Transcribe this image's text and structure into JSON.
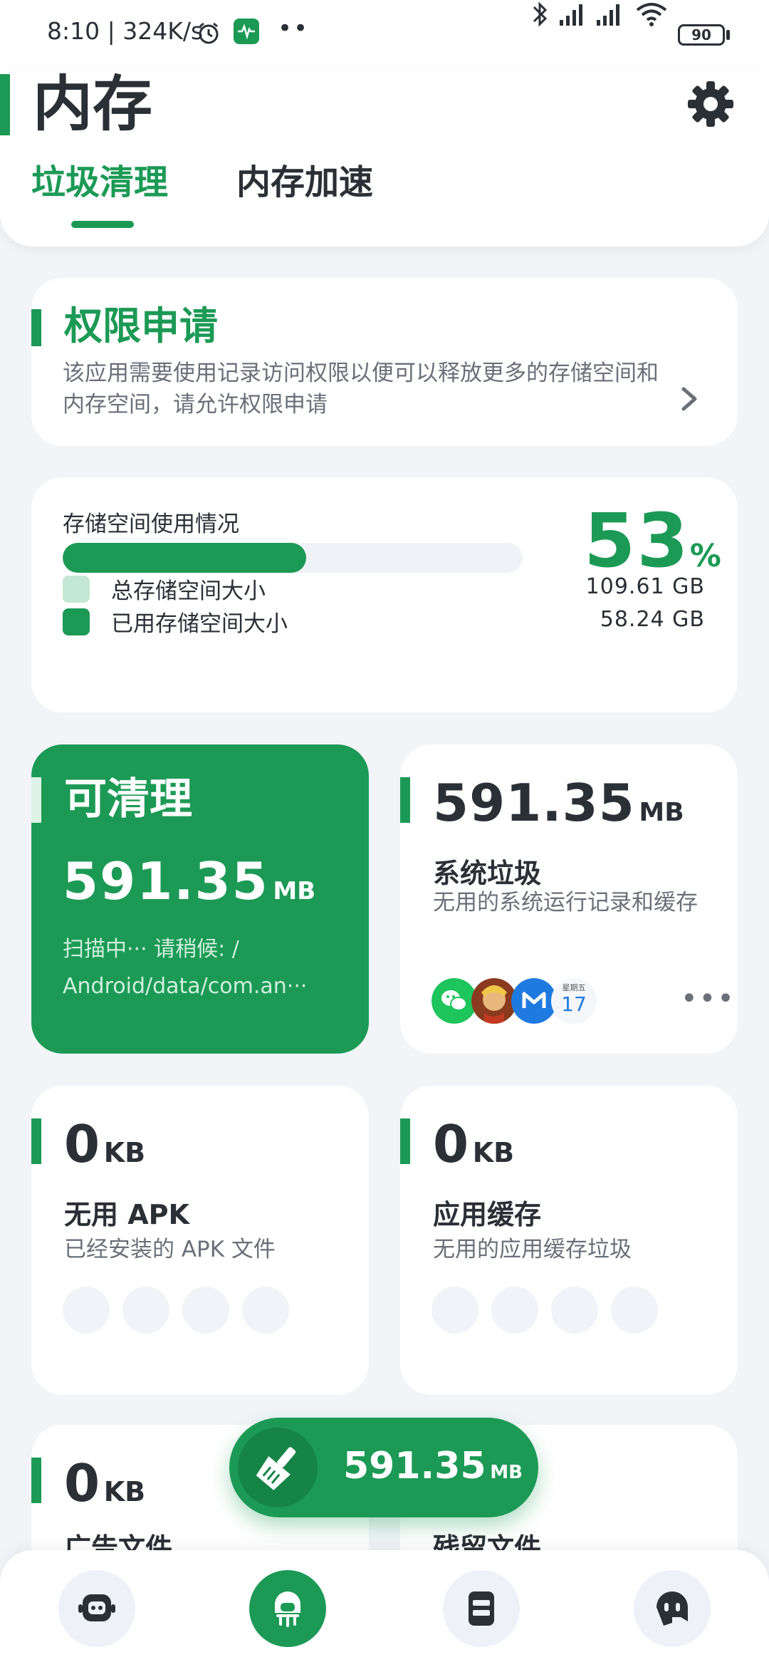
{
  "status_bar": {
    "time_speed": "8:10 | 324K/s",
    "dots": "••",
    "battery": "90"
  },
  "header": {
    "title": "内存",
    "tabs": [
      {
        "label": "垃圾清理",
        "active": true
      },
      {
        "label": "内存加速",
        "active": false
      }
    ]
  },
  "permission": {
    "title": "权限申请",
    "description": "该应用需要使用记录访问权限以便可以释放更多的存储空间和内存空间，请允许权限申请"
  },
  "storage": {
    "title": "存储空间使用情况",
    "percent_value": "53",
    "percent_unit": "%",
    "usage_fraction": 0.53,
    "legend": [
      {
        "label": "总存储空间大小",
        "value": "109.61 GB",
        "color": "#c3e8d3"
      },
      {
        "label": "已用存储空间大小",
        "value": "58.24 GB",
        "color": "#1c9a55"
      }
    ]
  },
  "cleanable": {
    "title": "可清理",
    "size_value": "591.35",
    "size_unit": "MB",
    "scan_line1": "扫描中··· 请稍候: /",
    "scan_line2": "Android/data/com.an···"
  },
  "system_junk": {
    "size_value": "591.35",
    "size_unit": "MB",
    "title": "系统垃圾",
    "description": "无用的系统运行记录和缓存",
    "app_icons": [
      "wechat-icon",
      "game-hero-icon",
      "m-app-icon",
      "calendar-icon"
    ],
    "calendar_weekday": "星期五",
    "calendar_day": "17",
    "more": "•••"
  },
  "useless_apk": {
    "size_value": "0",
    "size_unit": "KB",
    "title": "无用 APK",
    "description": "已经安装的 APK 文件"
  },
  "app_cache": {
    "size_value": "0",
    "size_unit": "KB",
    "title": "应用缓存",
    "description": "无用的应用缓存垃圾"
  },
  "ad_files": {
    "size_value": "0",
    "size_unit": "KB",
    "title": "广告文件"
  },
  "residual_files": {
    "title": "残留文件"
  },
  "clean_button": {
    "size_value": "591.35",
    "size_unit": "MB"
  },
  "bottom_nav": [
    {
      "icon": "robot-icon",
      "active": false
    },
    {
      "icon": "clean-robot-icon",
      "active": true
    },
    {
      "icon": "storage-icon",
      "active": false
    },
    {
      "icon": "chat-icon",
      "active": false
    }
  ],
  "colors": {
    "accent": "#1c9a55",
    "background": "#f2f4f8",
    "card": "#ffffff"
  }
}
